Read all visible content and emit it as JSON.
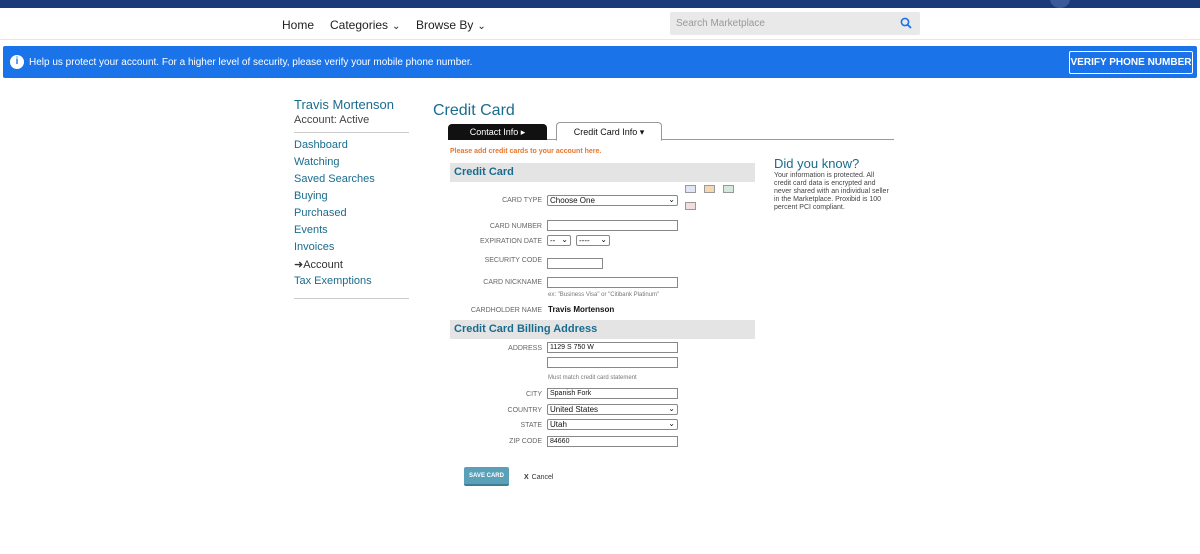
{
  "nav": {
    "home": "Home",
    "categories": "Categories",
    "browse_by": "Browse By",
    "search_placeholder": "Search Marketplace"
  },
  "banner": {
    "message": "Help us protect your account. For a higher level of security, please verify your mobile phone number.",
    "button": "VERIFY PHONE NUMBER"
  },
  "sidebar": {
    "name": "Travis Mortenson",
    "status": "Account: Active",
    "items": [
      {
        "label": "Dashboard"
      },
      {
        "label": "Watching"
      },
      {
        "label": "Saved Searches"
      },
      {
        "label": "Buying"
      },
      {
        "label": "Purchased"
      },
      {
        "label": "Events"
      },
      {
        "label": "Invoices"
      },
      {
        "label": "Account"
      },
      {
        "label": "Tax Exemptions"
      }
    ]
  },
  "page": {
    "title": "Credit Card",
    "tab_contact": "Contact Info",
    "tab_card": "Credit Card Info",
    "add_message": "Please add credit cards to your account here."
  },
  "credit_card": {
    "section": "Credit Card",
    "card_type_label": "CARD TYPE",
    "card_type_value": "Choose One",
    "card_number_label": "CARD NUMBER",
    "card_number_value": "",
    "expiration_label": "EXPIRATION DATE",
    "exp_month": "--",
    "exp_year": "----",
    "security_label": "SECURITY CODE",
    "security_value": "",
    "nickname_label": "CARD NICKNAME",
    "nickname_value": "",
    "nickname_hint": "ex: \"Business Visa\" or \"Citibank Platinum\"",
    "holder_label": "CARDHOLDER NAME",
    "holder_value": "Travis  Mortenson"
  },
  "billing": {
    "section": "Credit Card Billing Address",
    "address_label": "ADDRESS",
    "address1": "1129 S 750 W",
    "address2": "",
    "address_hint": "Must match credit card statement",
    "city_label": "CITY",
    "city": "Spanish Fork",
    "country_label": "COUNTRY",
    "country": "United States",
    "state_label": "STATE",
    "state": "Utah",
    "zip_label": "ZIP CODE",
    "zip": "84660"
  },
  "did_you_know": {
    "heading": "Did you know?",
    "text": "Your information is protected. All credit card data is encrypted and never shared with an individual seller in the Marketplace. Proxibid is 100 percent PCI compliant."
  },
  "actions": {
    "save": "SAVE CARD",
    "cancel_x": "X",
    "cancel": "Cancel"
  },
  "colors": {
    "brand_navy": "#1b3a7a",
    "banner_blue": "#1a73e8",
    "link_teal": "#1a6c8e",
    "alert_orange": "#e8762b"
  }
}
